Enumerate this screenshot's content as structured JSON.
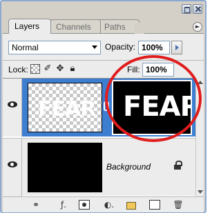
{
  "tabs": [
    {
      "label": "Layers",
      "active": true
    },
    {
      "label": "Channels",
      "active": false
    },
    {
      "label": "Paths",
      "active": false
    }
  ],
  "blend_mode": {
    "value": "Normal"
  },
  "opacity": {
    "label": "Opacity:",
    "value": "100%"
  },
  "lock": {
    "label": "Lock:"
  },
  "fill": {
    "label": "Fill:",
    "value": "100%"
  },
  "layers": [
    {
      "thumb_text": "FEAR",
      "mask_text": "FEAR",
      "selected": true,
      "visible": true,
      "has_mask": true
    },
    {
      "name": "Background",
      "selected": false,
      "visible": true,
      "locked": true
    }
  ],
  "toolbar": {
    "icons": [
      "link-layers-icon",
      "layer-style-icon",
      "add-mask-icon",
      "adjustment-layer-icon",
      "new-group-icon",
      "new-layer-icon",
      "trash-icon"
    ]
  },
  "colors": {
    "selected_row": "#3d7ed1",
    "annotation": "#e01c1c",
    "panel_bg": "#ececec"
  }
}
